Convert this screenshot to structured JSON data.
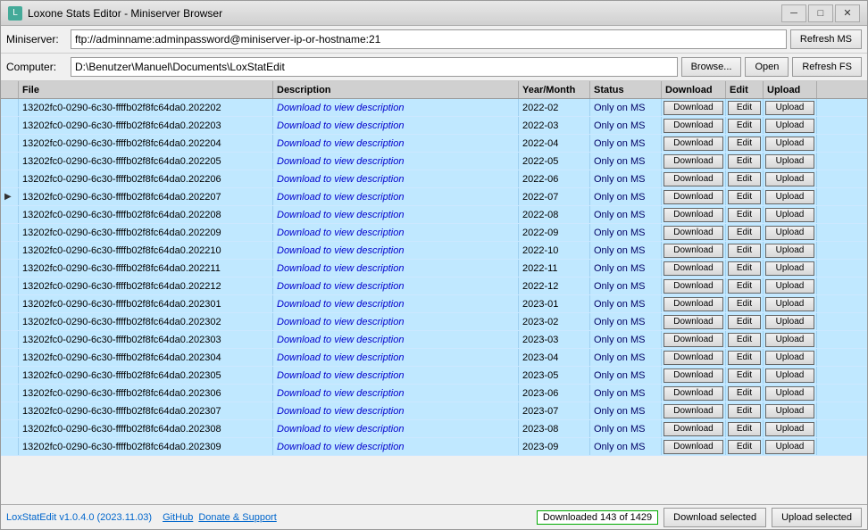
{
  "window": {
    "title": "Loxone Stats Editor - Miniserver Browser",
    "icon": "L"
  },
  "titlebar": {
    "minimize": "─",
    "maximize": "□",
    "close": "✕"
  },
  "miniserver": {
    "label": "Miniserver:",
    "value": "ftp://adminname:adminpassword@miniserver-ip-or-hostname:21",
    "refresh_btn": "Refresh MS"
  },
  "computer": {
    "label": "Computer:",
    "value": "D:\\Benutzer\\Manuel\\Documents\\LoxStatEdit",
    "browse_btn": "Browse...",
    "open_btn": "Open",
    "refresh_btn": "Refresh FS"
  },
  "table": {
    "headers": [
      "",
      "File",
      "Description",
      "Year/Month",
      "Status",
      "Download",
      "Edit",
      "Upload"
    ],
    "rows": [
      {
        "file": "13202fc0-0290-6c30-ffffb02f8fc64da0.202202",
        "desc": "Download to view description",
        "year": "2022-02",
        "status": "Only on MS",
        "arrow": ""
      },
      {
        "file": "13202fc0-0290-6c30-ffffb02f8fc64da0.202203",
        "desc": "Download to view description",
        "year": "2022-03",
        "status": "Only on MS",
        "arrow": ""
      },
      {
        "file": "13202fc0-0290-6c30-ffffb02f8fc64da0.202204",
        "desc": "Download to view description",
        "year": "2022-04",
        "status": "Only on MS",
        "arrow": ""
      },
      {
        "file": "13202fc0-0290-6c30-ffffb02f8fc64da0.202205",
        "desc": "Download to view description",
        "year": "2022-05",
        "status": "Only on MS",
        "arrow": ""
      },
      {
        "file": "13202fc0-0290-6c30-ffffb02f8fc64da0.202206",
        "desc": "Download to view description",
        "year": "2022-06",
        "status": "Only on MS",
        "arrow": ""
      },
      {
        "file": "13202fc0-0290-6c30-ffffb02f8fc64da0.202207",
        "desc": "Download to view description",
        "year": "2022-07",
        "status": "Only on MS",
        "arrow": "▶"
      },
      {
        "file": "13202fc0-0290-6c30-ffffb02f8fc64da0.202208",
        "desc": "Download to view description",
        "year": "2022-08",
        "status": "Only on MS",
        "arrow": ""
      },
      {
        "file": "13202fc0-0290-6c30-ffffb02f8fc64da0.202209",
        "desc": "Download to view description",
        "year": "2022-09",
        "status": "Only on MS",
        "arrow": ""
      },
      {
        "file": "13202fc0-0290-6c30-ffffb02f8fc64da0.202210",
        "desc": "Download to view description",
        "year": "2022-10",
        "status": "Only on MS",
        "arrow": ""
      },
      {
        "file": "13202fc0-0290-6c30-ffffb02f8fc64da0.202211",
        "desc": "Download to view description",
        "year": "2022-11",
        "status": "Only on MS",
        "arrow": ""
      },
      {
        "file": "13202fc0-0290-6c30-ffffb02f8fc64da0.202212",
        "desc": "Download to view description",
        "year": "2022-12",
        "status": "Only on MS",
        "arrow": ""
      },
      {
        "file": "13202fc0-0290-6c30-ffffb02f8fc64da0.202301",
        "desc": "Download to view description",
        "year": "2023-01",
        "status": "Only on MS",
        "arrow": ""
      },
      {
        "file": "13202fc0-0290-6c30-ffffb02f8fc64da0.202302",
        "desc": "Download to view description",
        "year": "2023-02",
        "status": "Only on MS",
        "arrow": ""
      },
      {
        "file": "13202fc0-0290-6c30-ffffb02f8fc64da0.202303",
        "desc": "Download to view description",
        "year": "2023-03",
        "status": "Only on MS",
        "arrow": ""
      },
      {
        "file": "13202fc0-0290-6c30-ffffb02f8fc64da0.202304",
        "desc": "Download to view description",
        "year": "2023-04",
        "status": "Only on MS",
        "arrow": ""
      },
      {
        "file": "13202fc0-0290-6c30-ffffb02f8fc64da0.202305",
        "desc": "Download to view description",
        "year": "2023-05",
        "status": "Only on MS",
        "arrow": ""
      },
      {
        "file": "13202fc0-0290-6c30-ffffb02f8fc64da0.202306",
        "desc": "Download to view description",
        "year": "2023-06",
        "status": "Only on MS",
        "arrow": ""
      },
      {
        "file": "13202fc0-0290-6c30-ffffb02f8fc64da0.202307",
        "desc": "Download to view description",
        "year": "2023-07",
        "status": "Only on MS",
        "arrow": ""
      },
      {
        "file": "13202fc0-0290-6c30-ffffb02f8fc64da0.202308",
        "desc": "Download to view description",
        "year": "2023-08",
        "status": "Only on MS",
        "arrow": ""
      },
      {
        "file": "13202fc0-0290-6c30-ffffb02f8fc64da0.202309",
        "desc": "Download to view description",
        "year": "2023-09",
        "status": "Only on MS",
        "arrow": ""
      }
    ],
    "download_label": "Download",
    "edit_label": "Edit",
    "upload_label": "Upload"
  },
  "statusbar": {
    "version": "LoxStatEdit v1.0.4.0 (2023.11.03)",
    "github": "GitHub",
    "donate": "Donate & Support",
    "count": "Downloaded 143 of 1429",
    "download_selected": "Download selected",
    "upload_selected": "Upload selected"
  }
}
